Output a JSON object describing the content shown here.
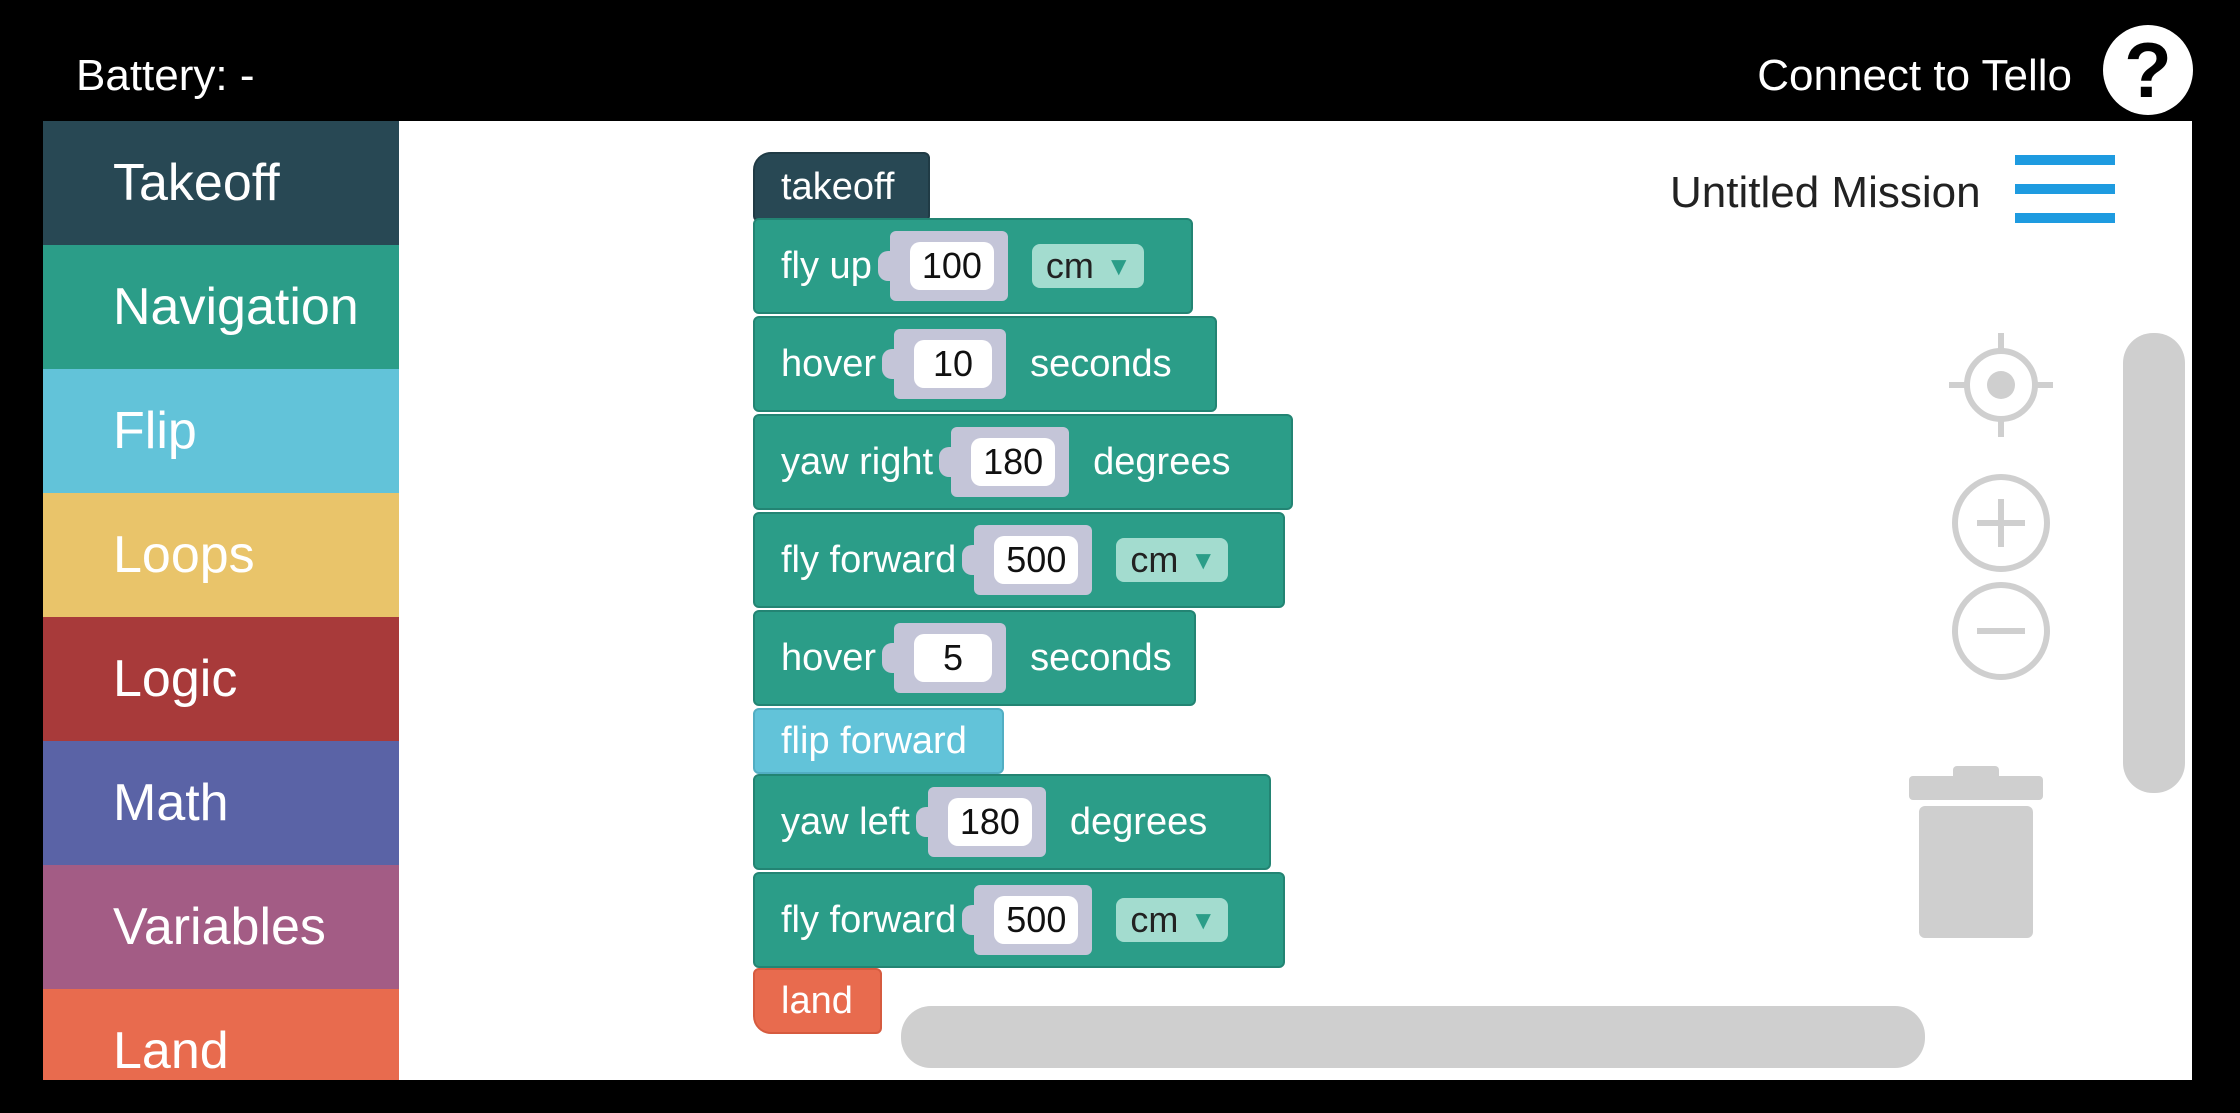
{
  "header": {
    "battery_label": "Battery: -",
    "connect_label": "Connect to Tello",
    "help_glyph": "?"
  },
  "sidebar": {
    "items": [
      {
        "label": "Takeoff",
        "color": "#284854"
      },
      {
        "label": "Navigation",
        "color": "#2b9d88"
      },
      {
        "label": "Flip",
        "color": "#62c3d9"
      },
      {
        "label": "Loops",
        "color": "#e9c46a"
      },
      {
        "label": "Logic",
        "color": "#a83a3a"
      },
      {
        "label": "Math",
        "color": "#5a63a6"
      },
      {
        "label": "Variables",
        "color": "#a35c85"
      },
      {
        "label": "Land",
        "color": "#e86b4e"
      }
    ]
  },
  "workspace": {
    "mission_title": "Untitled Mission",
    "blocks": {
      "takeoff": {
        "label": "takeoff"
      },
      "fly_up": {
        "label": "fly up",
        "value": "100",
        "unit": "cm"
      },
      "hover_1": {
        "label": "hover",
        "value": "10",
        "unit": "seconds"
      },
      "yaw_right": {
        "label": "yaw right",
        "value": "180",
        "unit": "degrees"
      },
      "fly_forward_1": {
        "label": "fly forward",
        "value": "500",
        "unit": "cm"
      },
      "hover_2": {
        "label": "hover",
        "value": "5",
        "unit": "seconds"
      },
      "flip_forward": {
        "label": "flip forward"
      },
      "yaw_left": {
        "label": "yaw left",
        "value": "180",
        "unit": "degrees"
      },
      "fly_forward_2": {
        "label": "fly forward",
        "value": "500",
        "unit": "cm"
      },
      "land": {
        "label": "land"
      }
    },
    "icons": [
      "menu-icon",
      "recenter-icon",
      "zoom-in-icon",
      "zoom-out-icon",
      "trash-icon"
    ]
  }
}
